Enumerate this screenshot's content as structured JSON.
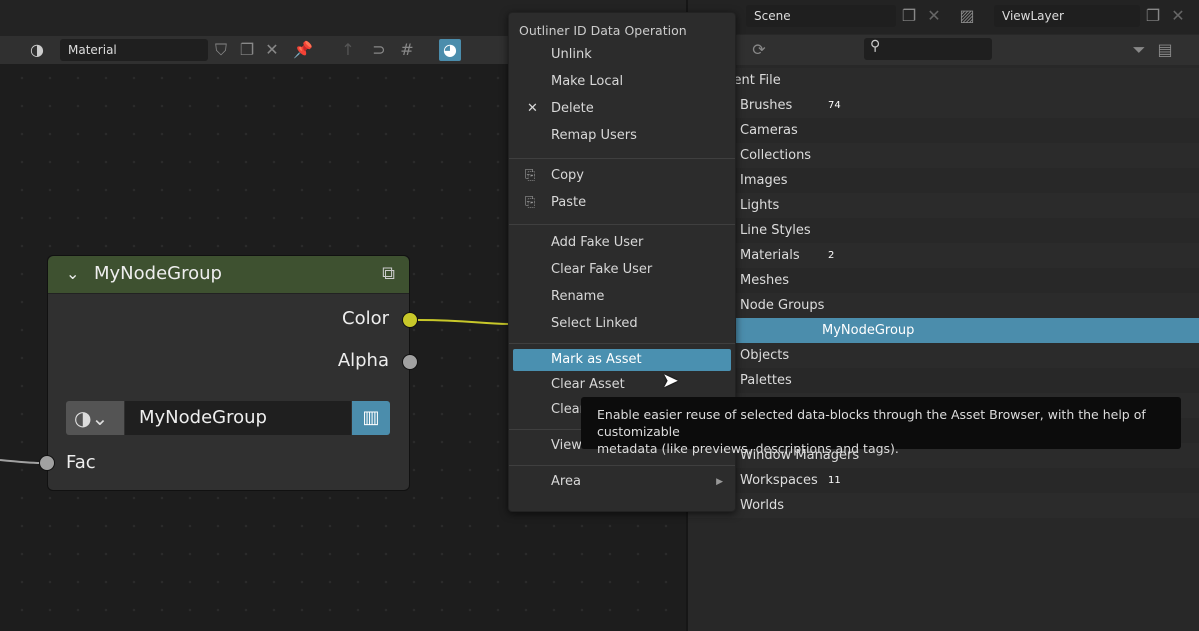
{
  "node_editor": {
    "header": {
      "shading": "Material",
      "datablock": "Material"
    },
    "node": {
      "title": "MyNodeGroup",
      "outputs": [
        "Color",
        "Alpha"
      ],
      "group_field": "MyNodeGroup",
      "inputs": [
        "Fac"
      ],
      "header_color": "#3e5130",
      "color_socket": "#c8c82a",
      "gray_socket": "#a1a1a1"
    }
  },
  "scene": {
    "scene_name": "Scene",
    "view_layer": "ViewLayer"
  },
  "outliner": {
    "root": "Current File",
    "rows": [
      {
        "label": "Brushes",
        "badge": "74"
      },
      {
        "label": "Cameras"
      },
      {
        "label": "Collections"
      },
      {
        "label": "Images"
      },
      {
        "label": "Lights"
      },
      {
        "label": "Line Styles"
      },
      {
        "label": "Materials",
        "badge": "2"
      },
      {
        "label": "Meshes"
      },
      {
        "label": "Node Groups"
      },
      {
        "label": "MyNodeGroup",
        "selected": true
      },
      {
        "label": "Objects"
      },
      {
        "label": "Palettes"
      },
      {
        "label": ""
      },
      {
        "label": ""
      },
      {
        "label": "Window Managers"
      },
      {
        "label": "Workspaces",
        "badge": "11"
      },
      {
        "label": "Worlds"
      }
    ]
  },
  "context_menu": {
    "title": "Outliner ID Data Operation",
    "items": [
      "Unlink",
      "Make Local",
      "Delete",
      "Remap Users",
      "Copy",
      "Paste",
      "Add Fake User",
      "Clear Fake User",
      "Rename",
      "Select Linked",
      "Mark as Asset",
      "Clear Asset",
      "Clear",
      "View",
      "Area"
    ],
    "highlighted": "Mark as Asset",
    "highlight_color": "#4a90b0"
  },
  "tooltip": {
    "line1": "Enable easier reuse of selected data-blocks through the Asset Browser, with the help of customizable",
    "line2": "metadata (like previews, descriptions and tags)."
  }
}
